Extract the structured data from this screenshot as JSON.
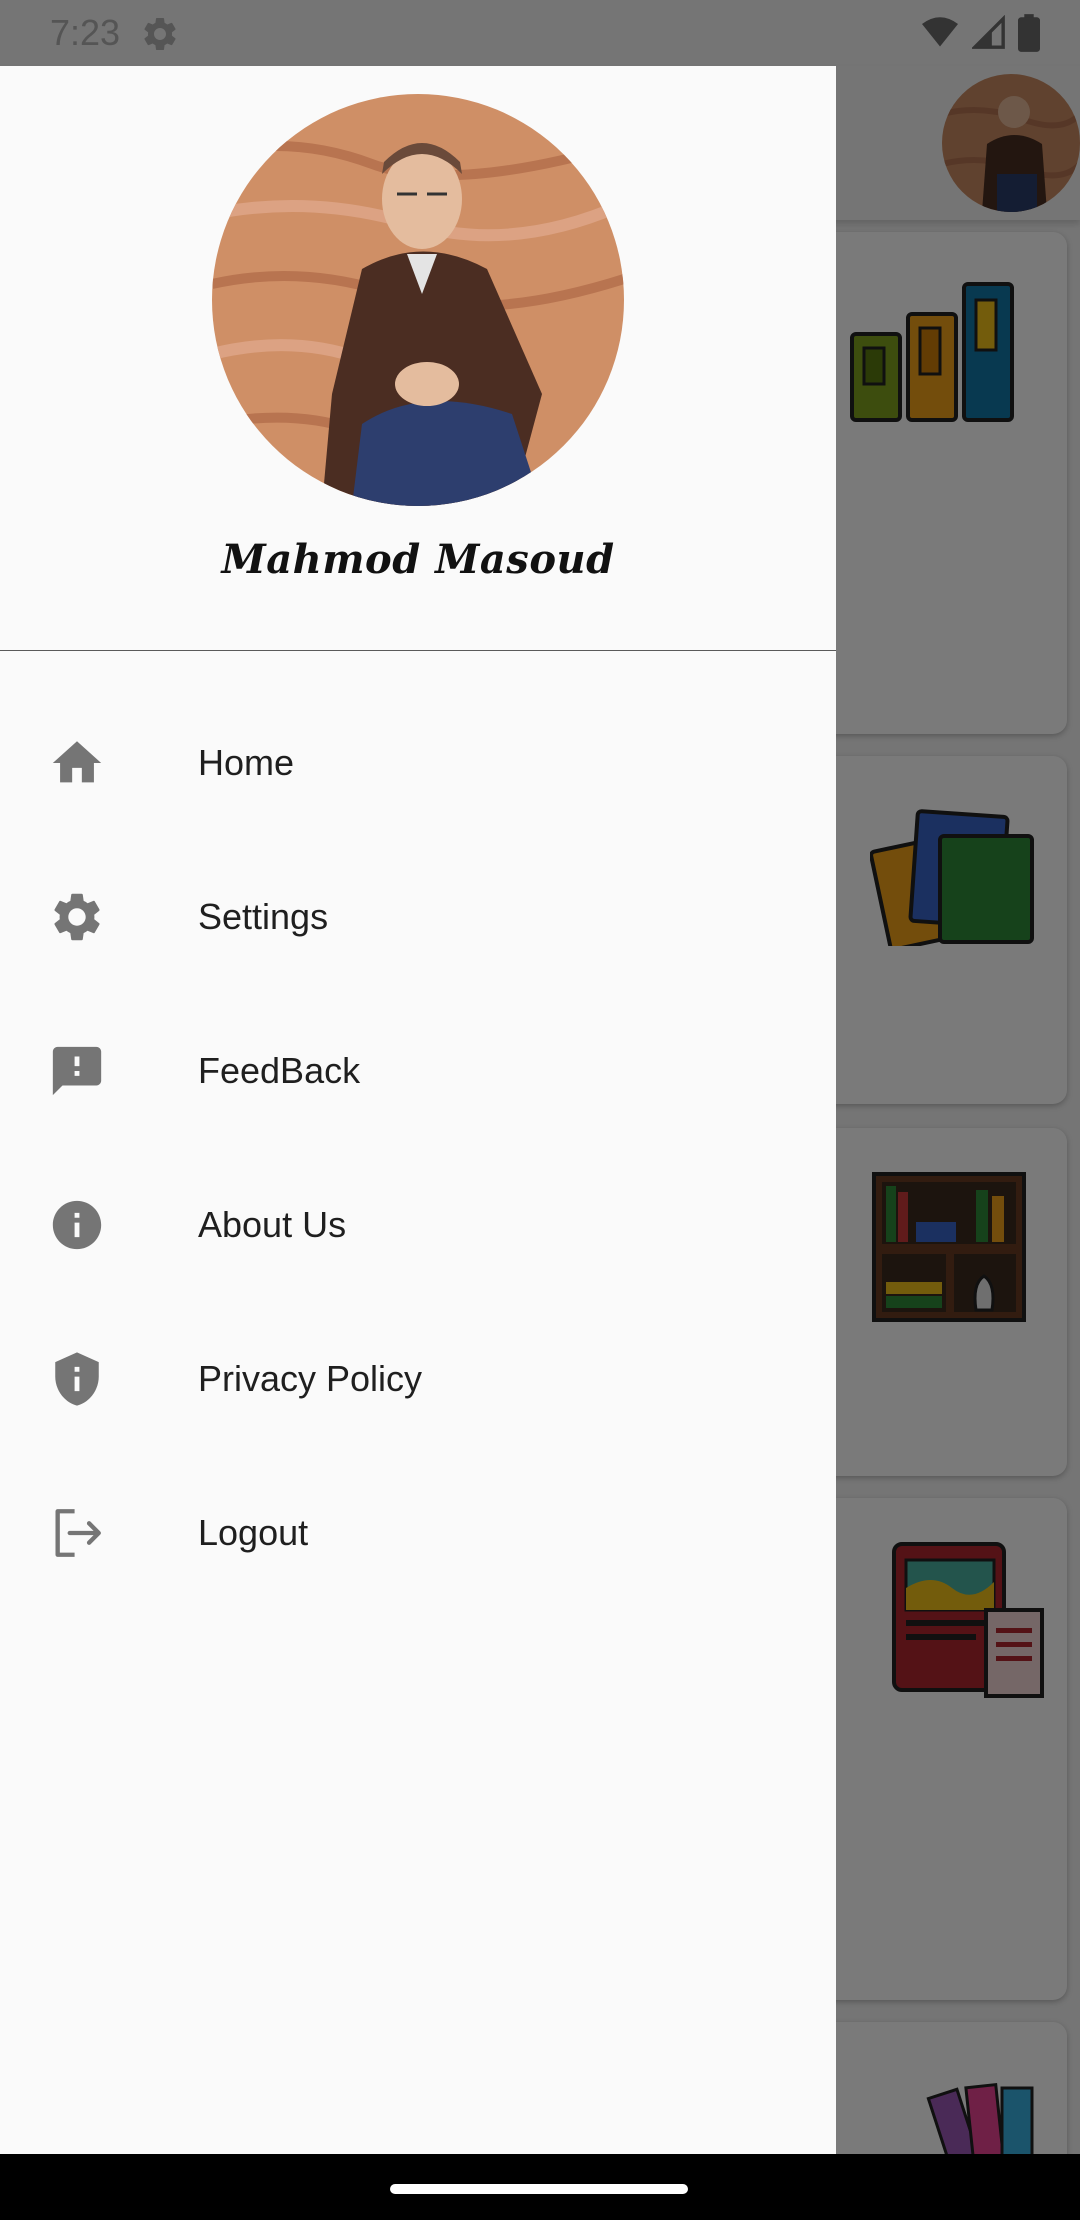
{
  "status_bar": {
    "time": "7:23",
    "icons": [
      "gear-icon",
      "wifi-icon",
      "signal-icon",
      "battery-icon"
    ]
  },
  "drawer": {
    "profile": {
      "name": "Mahmod Masoud",
      "photo": "profile-photo"
    },
    "items": [
      {
        "label": "Home",
        "icon": "home-icon"
      },
      {
        "label": "Settings",
        "icon": "gear-icon"
      },
      {
        "label": "FeedBack",
        "icon": "feedback-icon"
      },
      {
        "label": "About Us",
        "icon": "info-icon"
      },
      {
        "label": "Privacy Policy",
        "icon": "shield-icon"
      },
      {
        "label": "Logout",
        "icon": "logout-icon"
      }
    ]
  },
  "background_app": {
    "cards": [
      "books-bars-illustration",
      "stacked-books-illustration",
      "bookshelf-illustration",
      "book-with-papers-illustration",
      "colorful-books-illustration"
    ]
  },
  "colors": {
    "drawer_bg": "#fafafa",
    "icon_gray": "#757575",
    "label_text": "#1f1f1f",
    "scrim": "rgba(0,0,0,0.52)",
    "divider": "#5a5a5a"
  }
}
